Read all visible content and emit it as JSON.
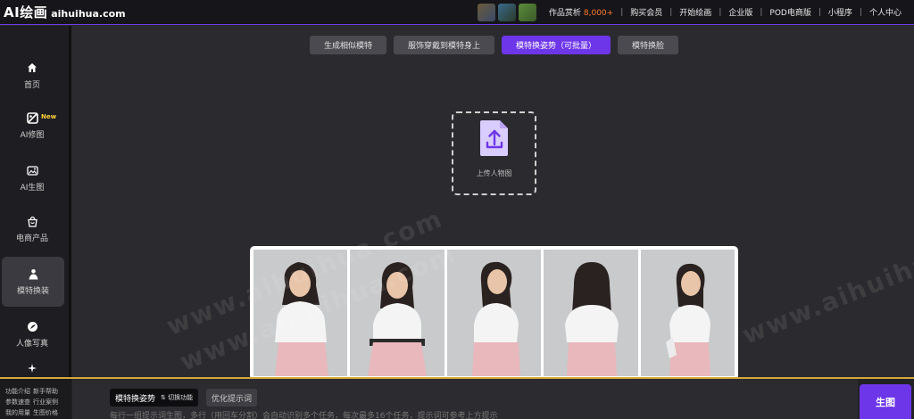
{
  "header": {
    "logo_main": "AI绘画",
    "logo_domain": "aihuihua.com",
    "nav": {
      "gallery_label": "作品赏析",
      "gallery_count": "8,000+",
      "buy": "购买会员",
      "start": "开始绘画",
      "enterprise": "企业版",
      "pod": "POD电商版",
      "miniapp": "小程序",
      "profile": "个人中心"
    }
  },
  "sidebar": {
    "items": [
      {
        "label": "首页",
        "icon": "home-icon"
      },
      {
        "label": "AI修图",
        "icon": "image-edit-icon",
        "badge": "New"
      },
      {
        "label": "AI生图",
        "icon": "image-generate-icon"
      },
      {
        "label": "电商产品",
        "icon": "shopping-bag-icon"
      },
      {
        "label": "模特换装",
        "icon": "model-icon"
      },
      {
        "label": "人像写真",
        "icon": "portrait-icon"
      }
    ]
  },
  "tabs": [
    {
      "label": "生成相似模特"
    },
    {
      "label": "服饰穿戴到模特身上"
    },
    {
      "label": "模特换姿势（可批量）"
    },
    {
      "label": "模特换脸"
    }
  ],
  "upload": {
    "label": "上传人物图",
    "icon": "upload-file-icon"
  },
  "watermark": "www.aihuihua.com",
  "bottom": {
    "help_links": [
      "功能介绍",
      "新手帮助",
      "参数速查",
      "行业案例",
      "我的用量",
      "生图价格"
    ],
    "mode": "模特换姿势",
    "switch": "切换功能",
    "optimize": "优化提示词",
    "placeholder": "每行一组提示词生图，多行（用回车分割）会自动识别多个任务，每次最多16个任务，提示词可参考上方提示",
    "generate": "生图"
  },
  "colors": {
    "accent": "#6d36e8",
    "count": "#ff7a2a",
    "badge": "#ffd23a",
    "divider": "#d4a83a"
  }
}
